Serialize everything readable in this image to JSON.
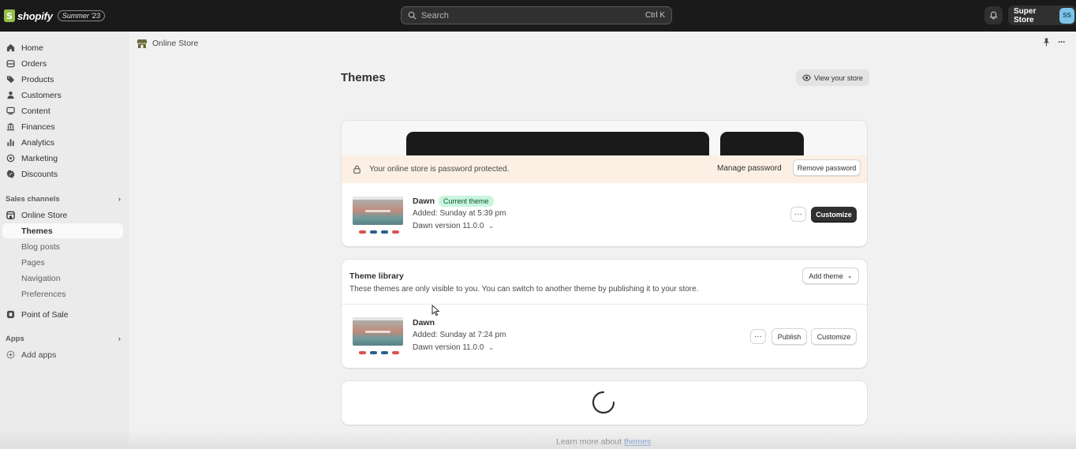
{
  "topbar": {
    "brand": "shopify",
    "edition": "Summer '23",
    "search_placeholder": "Search",
    "search_shortcut": "Ctrl K",
    "store_name": "Super Store",
    "avatar_initials": "SS"
  },
  "sidebar": {
    "items": [
      {
        "label": "Home",
        "icon": "home-icon"
      },
      {
        "label": "Orders",
        "icon": "orders-icon"
      },
      {
        "label": "Products",
        "icon": "tag-icon"
      },
      {
        "label": "Customers",
        "icon": "person-icon"
      },
      {
        "label": "Content",
        "icon": "content-icon"
      },
      {
        "label": "Finances",
        "icon": "bank-icon"
      },
      {
        "label": "Analytics",
        "icon": "bar-chart-icon"
      },
      {
        "label": "Marketing",
        "icon": "target-icon"
      },
      {
        "label": "Discounts",
        "icon": "discount-icon"
      }
    ],
    "sales_channels_label": "Sales channels",
    "online_store_label": "Online Store",
    "sub_items": [
      "Themes",
      "Blog posts",
      "Pages",
      "Navigation",
      "Preferences"
    ],
    "point_of_sale_label": "Point of Sale",
    "apps_label": "Apps",
    "add_apps_label": "Add apps"
  },
  "breadcrumb": {
    "label": "Online Store"
  },
  "page": {
    "title": "Themes",
    "view_store_label": "View your store"
  },
  "current_theme": {
    "banner_text": "Your online store is password protected.",
    "manage_password_label": "Manage password",
    "remove_password_label": "Remove password",
    "name": "Dawn",
    "badge": "Current theme",
    "added": "Added: Sunday at 5:39 pm",
    "version": "Dawn version 11.0.0",
    "dots_label": "···",
    "customize_label": "Customize"
  },
  "library": {
    "title": "Theme library",
    "add_theme_label": "Add theme",
    "description": "These themes are only visible to you. You can switch to another theme by publishing it to your store.",
    "theme": {
      "name": "Dawn",
      "added": "Added: Sunday at 7:24 pm",
      "version": "Dawn version 11.0.0",
      "dots_label": "···",
      "publish_label": "Publish",
      "customize_label": "Customize"
    }
  },
  "footer": {
    "learn_prefix": "Learn more about ",
    "learn_link": "themes"
  },
  "colors": {
    "topbar_bg": "#1a1a1a",
    "badge_bg": "#c9f5df",
    "banner_bg": "#fcf0e4",
    "link": "#2c6ecb",
    "swatches": [
      "#d9534f",
      "#2d5f8a",
      "#2d5f8a",
      "#d9534f"
    ]
  }
}
